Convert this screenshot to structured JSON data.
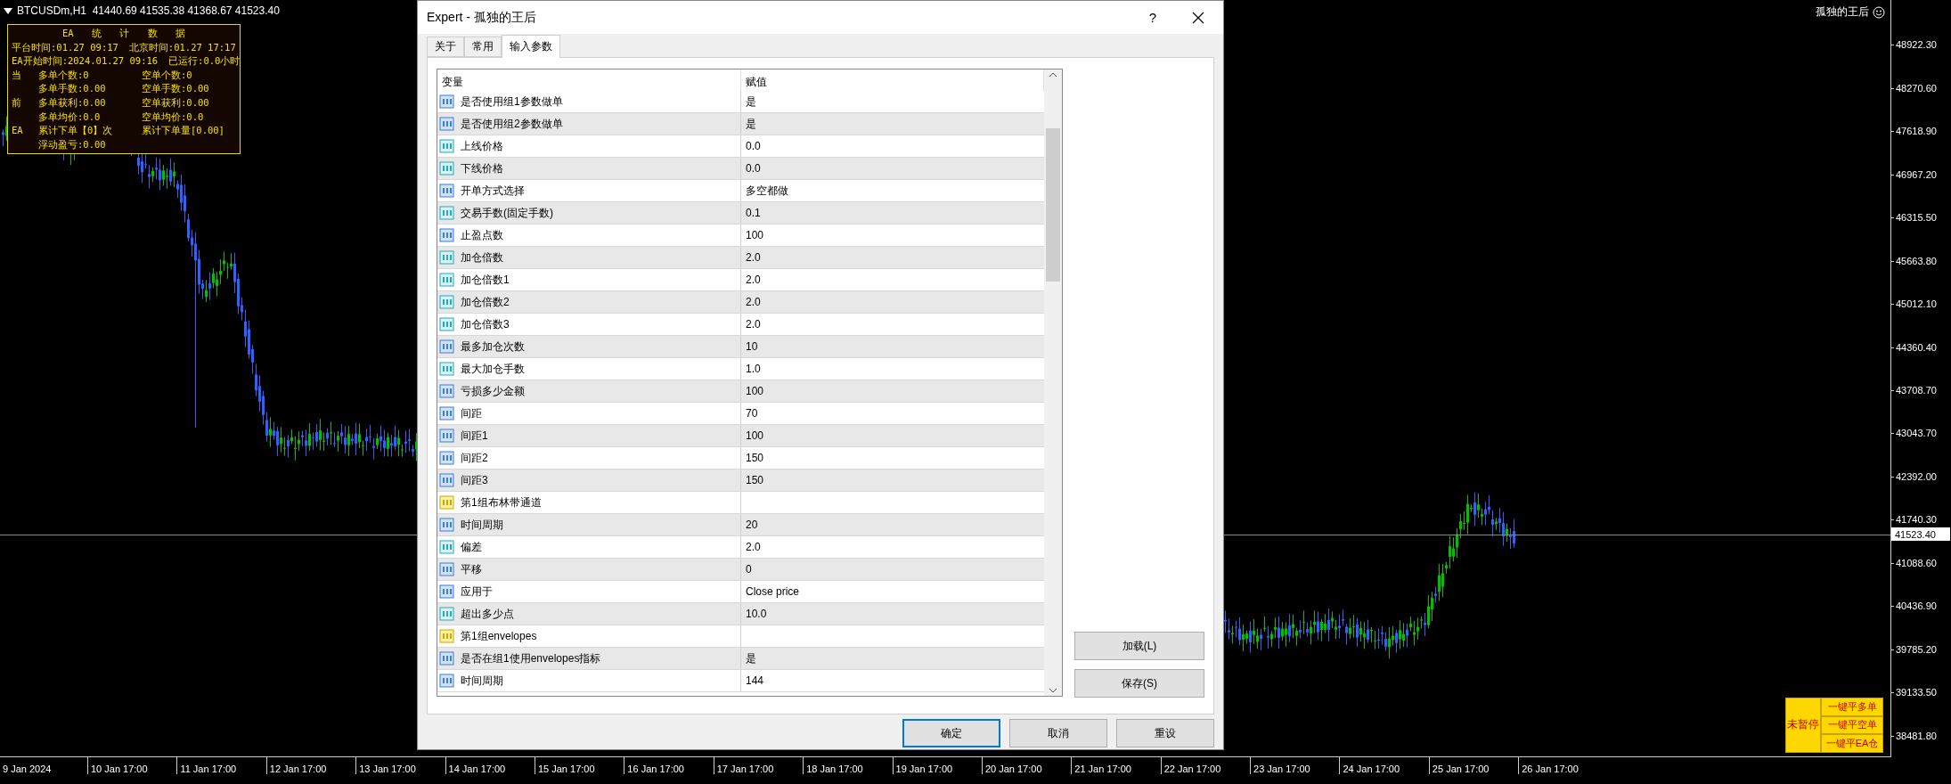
{
  "chart": {
    "symbol_line": "BTCUSDm,H1  41440.69 41535.38 41368.67 41523.40",
    "expert_label": "孤独的王后",
    "current_price": "41523.40"
  },
  "info_panel": {
    "title": "EA 统 计 数 据",
    "header_rows": [
      [
        "平台时间:01.27 09:17",
        "北京时间:01.27 17:17"
      ],
      [
        "EA开始时间:2024.01.27 09:16",
        "已运行:0.0小时"
      ]
    ],
    "stat_rows": [
      {
        "side": "当",
        "long": "多单个数:0",
        "short": "空单个数:0"
      },
      {
        "long": "多单手数:0.00",
        "short": "空单手数:0.00"
      },
      {
        "side": "前",
        "long": "多单获利:0.00",
        "short": "空单获利:0.00"
      },
      {
        "long": "多单均价:0.0",
        "short": "空单均价:0.0"
      },
      {
        "side": "EA",
        "long": "累计下单【0】次",
        "short": "累计下单量[0.00]"
      },
      {
        "long": "浮动盈亏:0.00"
      }
    ]
  },
  "control_buttons": {
    "status": "未暂停",
    "actions": [
      "一键平多单",
      "一键平空单",
      "一键平EA仓"
    ]
  },
  "price_axis": [
    "48922.30",
    "48270.60",
    "47618.90",
    "46967.20",
    "46315.50",
    "45663.80",
    "45012.10",
    "44360.40",
    "43708.70",
    "43043.70",
    "42392.00",
    "41740.30",
    "41088.60",
    "40436.90",
    "39785.20",
    "39133.50",
    "38481.80"
  ],
  "time_axis": [
    "9 Jan 2024",
    "10 Jan 17:00",
    "11 Jan 17:00",
    "12 Jan 17:00",
    "13 Jan 17:00",
    "14 Jan 17:00",
    "15 Jan 17:00",
    "16 Jan 17:00",
    "17 Jan 17:00",
    "18 Jan 17:00",
    "19 Jan 17:00",
    "20 Jan 17:00",
    "21 Jan 17:00",
    "22 Jan 17:00",
    "23 Jan 17:00",
    "24 Jan 17:00",
    "25 Jan 17:00",
    "26 Jan 17:00"
  ],
  "dialog": {
    "title": "Expert - 孤独的王后",
    "help": "?",
    "tabs": [
      {
        "label": "关于",
        "selected": false
      },
      {
        "label": "常用",
        "selected": false
      },
      {
        "label": "输入参数",
        "selected": true
      }
    ],
    "columns": [
      "变量",
      "赋值"
    ],
    "params": [
      {
        "kind": "int",
        "name": "是否使用组1参数做单",
        "value": "是"
      },
      {
        "kind": "int",
        "name": "是否使用组2参数做单",
        "value": "是"
      },
      {
        "kind": "double",
        "name": "上线价格",
        "value": "0.0"
      },
      {
        "kind": "double",
        "name": "下线价格",
        "value": "0.0"
      },
      {
        "kind": "int",
        "name": "开单方式选择",
        "value": "多空都做"
      },
      {
        "kind": "double",
        "name": "交易手数(固定手数)",
        "value": "0.1"
      },
      {
        "kind": "int",
        "name": "止盈点数",
        "value": "100"
      },
      {
        "kind": "double",
        "name": "加仓倍数",
        "value": "2.0"
      },
      {
        "kind": "double",
        "name": "加仓倍数1",
        "value": "2.0"
      },
      {
        "kind": "double",
        "name": "加仓倍数2",
        "value": "2.0"
      },
      {
        "kind": "double",
        "name": "加仓倍数3",
        "value": "2.0"
      },
      {
        "kind": "int",
        "name": "最多加仓次数",
        "value": "10"
      },
      {
        "kind": "double",
        "name": "最大加仓手数",
        "value": "1.0"
      },
      {
        "kind": "int",
        "name": "亏损多少金额",
        "value": "100"
      },
      {
        "kind": "int",
        "name": "间距",
        "value": "70"
      },
      {
        "kind": "int",
        "name": "间距1",
        "value": "100"
      },
      {
        "kind": "int",
        "name": "间距2",
        "value": "150"
      },
      {
        "kind": "int",
        "name": "间距3",
        "value": "150"
      },
      {
        "kind": "string",
        "name": "第1组布林带通道"
      },
      {
        "kind": "int",
        "name": "时间周期",
        "value": "20"
      },
      {
        "kind": "double",
        "name": "偏差",
        "value": "2.0"
      },
      {
        "kind": "int",
        "name": "平移",
        "value": "0"
      },
      {
        "kind": "int",
        "name": "应用于",
        "value": "Close price"
      },
      {
        "kind": "double",
        "name": "超出多少点",
        "value": "10.0"
      },
      {
        "kind": "string",
        "name": "第1组envelopes"
      },
      {
        "kind": "int",
        "name": "是否在组1使用envelopes指标",
        "value": "是"
      },
      {
        "kind": "int",
        "name": "时间周期",
        "value": "144"
      }
    ],
    "side_buttons": [
      "加载(L)",
      "保存(S)"
    ],
    "buttons": [
      {
        "label": "确定",
        "default": true
      },
      {
        "label": "取消",
        "default": false
      },
      {
        "label": "重设",
        "default": false
      }
    ]
  }
}
